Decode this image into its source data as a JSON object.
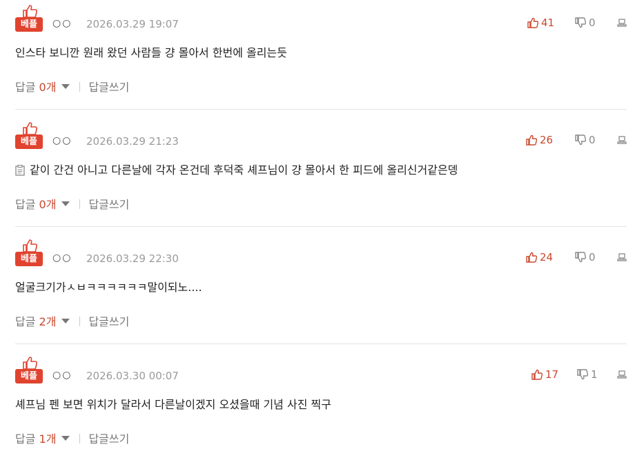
{
  "comments": [
    {
      "badge": "베플",
      "nickname": "○○",
      "datetime": "2026.03.29 19:07",
      "likes": "41",
      "dislikes": "0",
      "text": "인스타 보니깐 원래 왔던 사람들 걍 몰아서 한번에 올리는듯",
      "has_memo_icon": false,
      "reply_label": "답글",
      "reply_count": "0개",
      "write_reply": "답글쓰기"
    },
    {
      "badge": "베플",
      "nickname": "○○",
      "datetime": "2026.03.29 21:23",
      "likes": "26",
      "dislikes": "0",
      "text": "같이 간건 아니고 다른날에 각자 온건데 후덕죽 셰프님이 걍 몰아서 한 피드에 올리신거같은뎅",
      "has_memo_icon": true,
      "reply_label": "답글",
      "reply_count": "0개",
      "write_reply": "답글쓰기"
    },
    {
      "badge": "베플",
      "nickname": "○○",
      "datetime": "2026.03.29 22:30",
      "likes": "24",
      "dislikes": "0",
      "text": "얼굴크기가ㅅㅂㅋㅋㅋㅋㅋㅋ말이되노....",
      "has_memo_icon": false,
      "reply_label": "답글",
      "reply_count": "2개",
      "write_reply": "답글쓰기"
    },
    {
      "badge": "베플",
      "nickname": "○○",
      "datetime": "2026.03.30 00:07",
      "likes": "17",
      "dislikes": "1",
      "text": "셰프님 펜 보면 위치가 달라서 다른날이겠지 오셨을때 기념 사진 찍구",
      "has_memo_icon": false,
      "reply_label": "답글",
      "reply_count": "1개",
      "write_reply": "답글쓰기"
    }
  ],
  "colors": {
    "badge": "#e0432f",
    "likes": "#c9482f",
    "date": "#9a9a9a",
    "divider": "#e3e3e3"
  },
  "icons": {
    "badge": "thumbs-up-icon",
    "likes": "thumbs-up-icon",
    "dislikes": "thumbs-down-icon",
    "report": "report-icon",
    "memo": "memo-icon",
    "replies_toggle": "chevron-down-icon"
  }
}
